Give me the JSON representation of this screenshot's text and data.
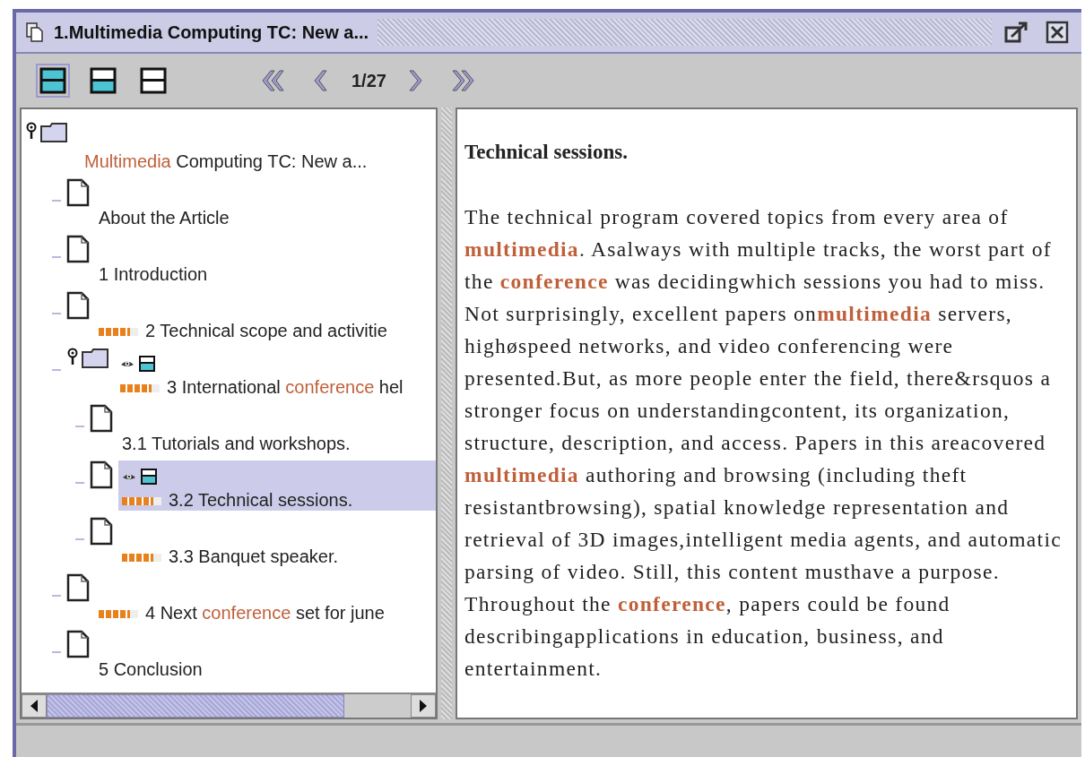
{
  "window": {
    "title": "1.Multimedia Computing TC: New a..."
  },
  "toolbar": {
    "views": [
      {
        "selected": true
      },
      {
        "selected": false
      },
      {
        "selected": false
      }
    ],
    "page": "1/27"
  },
  "tree": [
    {
      "kind": "folder",
      "label": "**Multimedia** Computing TC: New a...",
      "selected": false,
      "viewed": false,
      "children": [
        {
          "kind": "doc",
          "label": "About the Article",
          "selected": false,
          "viewed": false
        },
        {
          "kind": "doc",
          "label": "1 Introduction",
          "selected": false,
          "viewed": false
        },
        {
          "kind": "doc",
          "label": "2 Technical scope and activitie",
          "selected": false,
          "viewed": false,
          "level": 0.8
        },
        {
          "kind": "folder",
          "label": "3 International **conference** hel",
          "selected": false,
          "viewed": true,
          "level": 0.8,
          "children": [
            {
              "kind": "doc",
              "label": "3.1 Tutorials and workshops.",
              "selected": false,
              "viewed": false
            },
            {
              "kind": "doc",
              "label": "3.2 Technical sessions.",
              "selected": true,
              "viewed": true,
              "level": 0.8
            },
            {
              "kind": "doc",
              "label": "3.3 Banquet speaker.",
              "selected": false,
              "viewed": false,
              "level": 0.8
            }
          ]
        },
        {
          "kind": "doc",
          "label": "4 Next **conference** set for june",
          "selected": false,
          "viewed": false,
          "level": 0.8
        },
        {
          "kind": "doc",
          "label": "5 Conclusion",
          "selected": false,
          "viewed": false
        }
      ]
    }
  ],
  "content": {
    "heading": "Technical sessions.",
    "body": "The technical program covered topics from every area of **multimedia**. Asalways with multiple tracks, the worst part of the **conference** was decidingwhich sessions you had to miss. Not surprisingly, excellent papers on**multimedia** servers, highøspeed networks, and video conferencing were presented.But, as more people enter the field, there&rsquos a stronger focus on understandingcontent, its organization, structure, description, and access. Papers in this areacovered **multimedia** authoring and browsing (including theft resistantbrowsing), spatial knowledge representation and retrieval of 3D images,intelligent media agents, and automatic parsing of video. Still, this content musthave a purpose. Throughout the **conference**, papers could be found describingapplications in education, business, and entertainment."
  }
}
